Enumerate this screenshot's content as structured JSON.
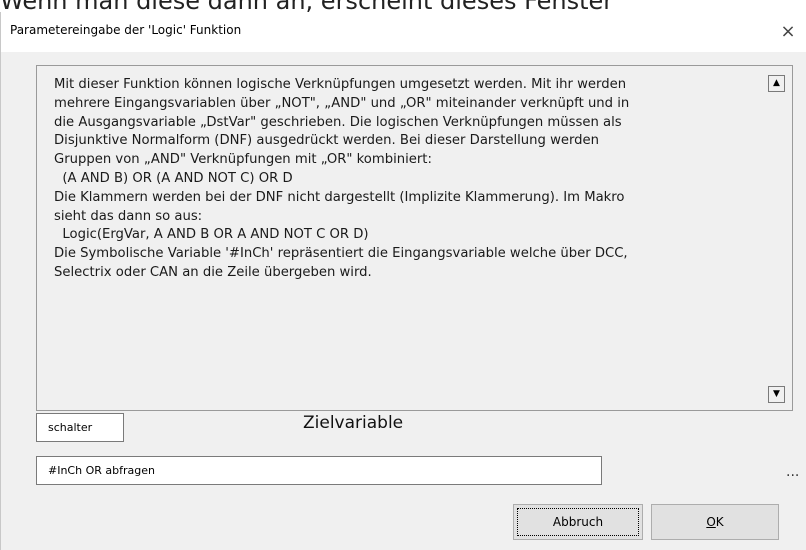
{
  "caption": "Wenn man diese dann an, erscheint dieses Fenster",
  "dialog": {
    "title": "Parametereingabe der 'Logic' Funktion",
    "close_label": "×"
  },
  "description": {
    "text": "Mit dieser Funktion können logische Verknüpfungen umgesetzt werden. Mit ihr werden\nmehrere Eingangsvariablen über „NOT\", „AND\" und „OR\" miteinander verknüpft und in\ndie Ausgangsvariable „DstVar\" geschrieben. Die logischen Verknüpfungen müssen als\nDisjunktive Normalform (DNF) ausgedrückt werden. Bei dieser Darstellung werden\nGruppen von „AND\" Verknüpfungen mit „OR\" kombiniert:\n  (A AND B) OR (A AND NOT C) OR D\nDie Klammern werden bei der DNF nicht dargestellt (Implizite Klammerung). Im Makro\nsieht das dann so aus:\n  Logic(ErgVar, A AND B OR A AND NOT C OR D)\nDie Symbolische Variable '#InCh' repräsentiert die Eingangsvariable welche über DCC,\nSelectrix oder CAN an die Zeile übergeben wird."
  },
  "scroll": {
    "up_icon": "▲",
    "down_icon": "▼"
  },
  "fields": {
    "target_value": "schalter",
    "target_label": "Zielvariable",
    "expression_value": "#InCh OR abfragen",
    "ellipsis": "..."
  },
  "buttons": {
    "cancel_label": "Abbruch",
    "ok_mnemonic": "O",
    "ok_rest": "K"
  }
}
